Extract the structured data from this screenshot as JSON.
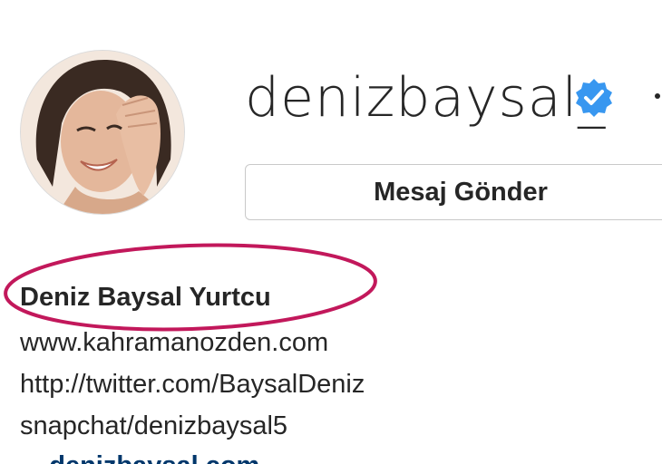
{
  "profile": {
    "username": "denizbaysal_",
    "verified": true,
    "full_name": "Deniz Baysal Yurtcu",
    "message_button_label": "Mesaj Gönder",
    "bio_lines": [
      "www.kahramanozden.com",
      "http://twitter.com/BaysalDeniz",
      "snapchat/denizbaysal5"
    ],
    "partial_link": "... denizbaysal.com ..."
  },
  "icons": {
    "verified": "verified-badge-icon",
    "more": "more-options-icon"
  },
  "colors": {
    "verified_blue": "#3897f0",
    "highlight_red": "#c2185b",
    "link_blue": "#00376b",
    "text": "#262626",
    "button_border": "#c9c9c9"
  }
}
